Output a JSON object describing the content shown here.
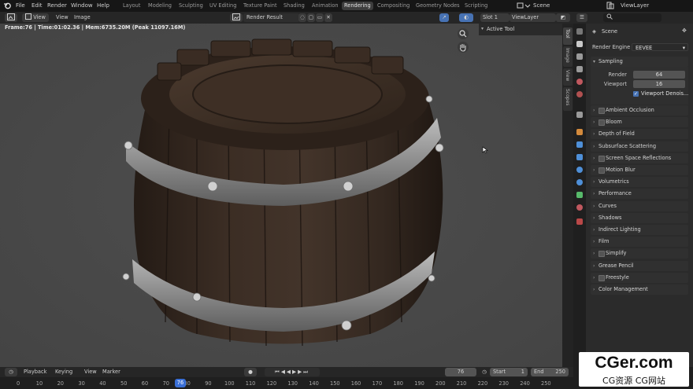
{
  "topbar": {
    "menus": [
      "File",
      "Edit",
      "Render",
      "Window",
      "Help"
    ],
    "workspaces": [
      "Layout",
      "Modeling",
      "Sculpting",
      "UV Editing",
      "Texture Paint",
      "Shading",
      "Animation",
      "Rendering",
      "Compositing",
      "Geometry Nodes",
      "Scripting"
    ],
    "active_workspace": "Rendering",
    "scene_label": "Scene",
    "viewlayer_label": "ViewLayer"
  },
  "image_editor": {
    "view_menu": "View",
    "menus": [
      "View",
      "Image"
    ],
    "image_name": "Render Result",
    "slot": "Slot 1",
    "view_layer": "ViewLayer",
    "frame_stats": "Frame:76 | Time:01:02.36 | Mem:6735.20M (Peak 11097.16M)",
    "active_tool": "Active Tool",
    "side_tabs": [
      "Tool",
      "Image",
      "View",
      "Scopes"
    ]
  },
  "properties": {
    "breadcrumb": "Scene",
    "render_engine_label": "Render Engine",
    "render_engine_value": "EEVEE",
    "sampling": {
      "title": "Sampling",
      "render_label": "Render",
      "render_value": "64",
      "viewport_label": "Viewport",
      "viewport_value": "16",
      "denoise_label": "Viewport Denois..."
    },
    "panels": [
      {
        "label": "Ambient Occlusion",
        "checkbox": true
      },
      {
        "label": "Bloom",
        "checkbox": true
      },
      {
        "label": "Depth of Field",
        "checkbox": false
      },
      {
        "label": "Subsurface Scattering",
        "checkbox": false
      },
      {
        "label": "Screen Space Reflections",
        "checkbox": true
      },
      {
        "label": "Motion Blur",
        "checkbox": true
      },
      {
        "label": "Volumetrics",
        "checkbox": false
      },
      {
        "label": "Performance",
        "checkbox": false
      },
      {
        "label": "Curves",
        "checkbox": false
      },
      {
        "label": "Shadows",
        "checkbox": false
      },
      {
        "label": "Indirect Lighting",
        "checkbox": false
      },
      {
        "label": "Film",
        "checkbox": false
      },
      {
        "label": "Simplify",
        "checkbox": true
      },
      {
        "label": "Grease Pencil",
        "checkbox": false
      },
      {
        "label": "Freestyle",
        "checkbox": true
      },
      {
        "label": "Color Management",
        "checkbox": false
      }
    ]
  },
  "timeline": {
    "menus": [
      "Playback",
      "Keying",
      "View",
      "Marker"
    ],
    "current_frame": "76",
    "start_label": "Start",
    "start_value": "1",
    "end_label": "End",
    "end_value": "250",
    "ticks": [
      "0",
      "10",
      "20",
      "30",
      "40",
      "50",
      "60",
      "70",
      "80",
      "90",
      "100",
      "110",
      "120",
      "130",
      "140",
      "150",
      "160",
      "170",
      "180",
      "190",
      "200",
      "210",
      "220",
      "230",
      "240",
      "250"
    ],
    "playhead_label": "76"
  },
  "watermark": {
    "title": "CGer.com",
    "subtitle": "CG资源 CG网站"
  },
  "colors": {
    "accent": "#3a6fd6",
    "canvas": "#4a4a4a",
    "panel": "#303030"
  }
}
